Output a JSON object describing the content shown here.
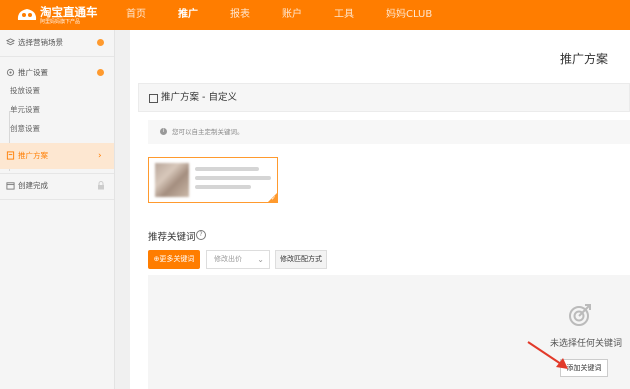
{
  "header": {
    "logo_title": "淘宝直通车",
    "logo_subtitle": "阿里妈妈旗下产品",
    "nav": [
      {
        "label": "首页",
        "active": false
      },
      {
        "label": "推广",
        "active": true
      },
      {
        "label": "报表",
        "active": false
      },
      {
        "label": "账户",
        "active": false
      },
      {
        "label": "工具",
        "active": false
      },
      {
        "label": "妈妈CLUB",
        "active": false
      }
    ]
  },
  "sidebar": {
    "steps": [
      {
        "label": "选择营销场景",
        "state": "done"
      },
      {
        "label": "推广设置",
        "state": "done"
      },
      {
        "label": "推广方案",
        "state": "current"
      },
      {
        "label": "创建完成",
        "state": "locked"
      }
    ],
    "sub_items": [
      "投放设置",
      "单元设置",
      "创意设置"
    ]
  },
  "main": {
    "page_title": "推广方案",
    "section_title": "推广方案 - 自定义",
    "tip": "您可以自主定制关键词。",
    "keyword_title": "推荐关键词",
    "more_keywords_label": "⊕更多关键词",
    "bid_select_value": "修改出价",
    "match_button_label": "修改匹配方式",
    "empty_text": "未选择任何关键词",
    "add_keyword_label": "添加关键词"
  },
  "colors": {
    "brand": "#ff7d00",
    "accent": "#ff9a2e"
  },
  "icons": [
    "layers-icon",
    "gear-icon",
    "document-icon",
    "calendar-icon",
    "lock-icon",
    "info-icon",
    "help-icon",
    "target-icon",
    "arrow-icon"
  ]
}
